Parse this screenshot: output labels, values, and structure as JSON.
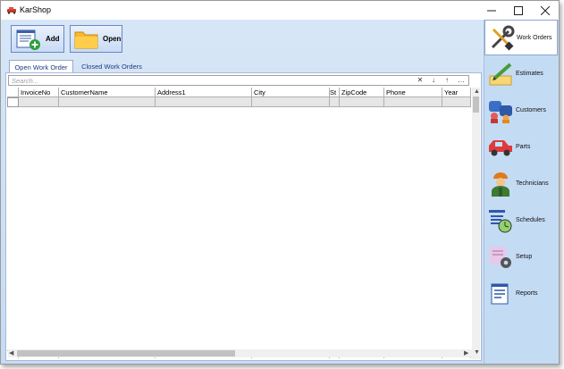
{
  "window": {
    "title": "KarShop"
  },
  "toolbar": {
    "add_label": "Add",
    "open_label": "Open"
  },
  "tabs": [
    {
      "label": "Open Work Order"
    },
    {
      "label": "Closed Work Orders"
    }
  ],
  "search": {
    "placeholder": "Search..."
  },
  "grid": {
    "columns": [
      {
        "label": "InvoiceNo"
      },
      {
        "label": "CustomerName"
      },
      {
        "label": "Address1"
      },
      {
        "label": "City"
      },
      {
        "label": "St"
      },
      {
        "label": "ZipCode"
      },
      {
        "label": "Phone"
      },
      {
        "label": "Year"
      }
    ]
  },
  "sidebar": {
    "items": [
      {
        "label": "Work Orders",
        "icon": "wrench-screwdriver-icon"
      },
      {
        "label": "Estimates",
        "icon": "pencil-paper-icon"
      },
      {
        "label": "Customers",
        "icon": "people-icon"
      },
      {
        "label": "Parts",
        "icon": "car-icon"
      },
      {
        "label": "Technicians",
        "icon": "mechanic-icon"
      },
      {
        "label": "Schedules",
        "icon": "schedule-clock-icon"
      },
      {
        "label": "Setup",
        "icon": "gear-icon"
      },
      {
        "label": "Reports",
        "icon": "report-icon"
      }
    ]
  },
  "colors": {
    "accent": "#6b86c0",
    "panel_bg": "#c6dbf3"
  }
}
